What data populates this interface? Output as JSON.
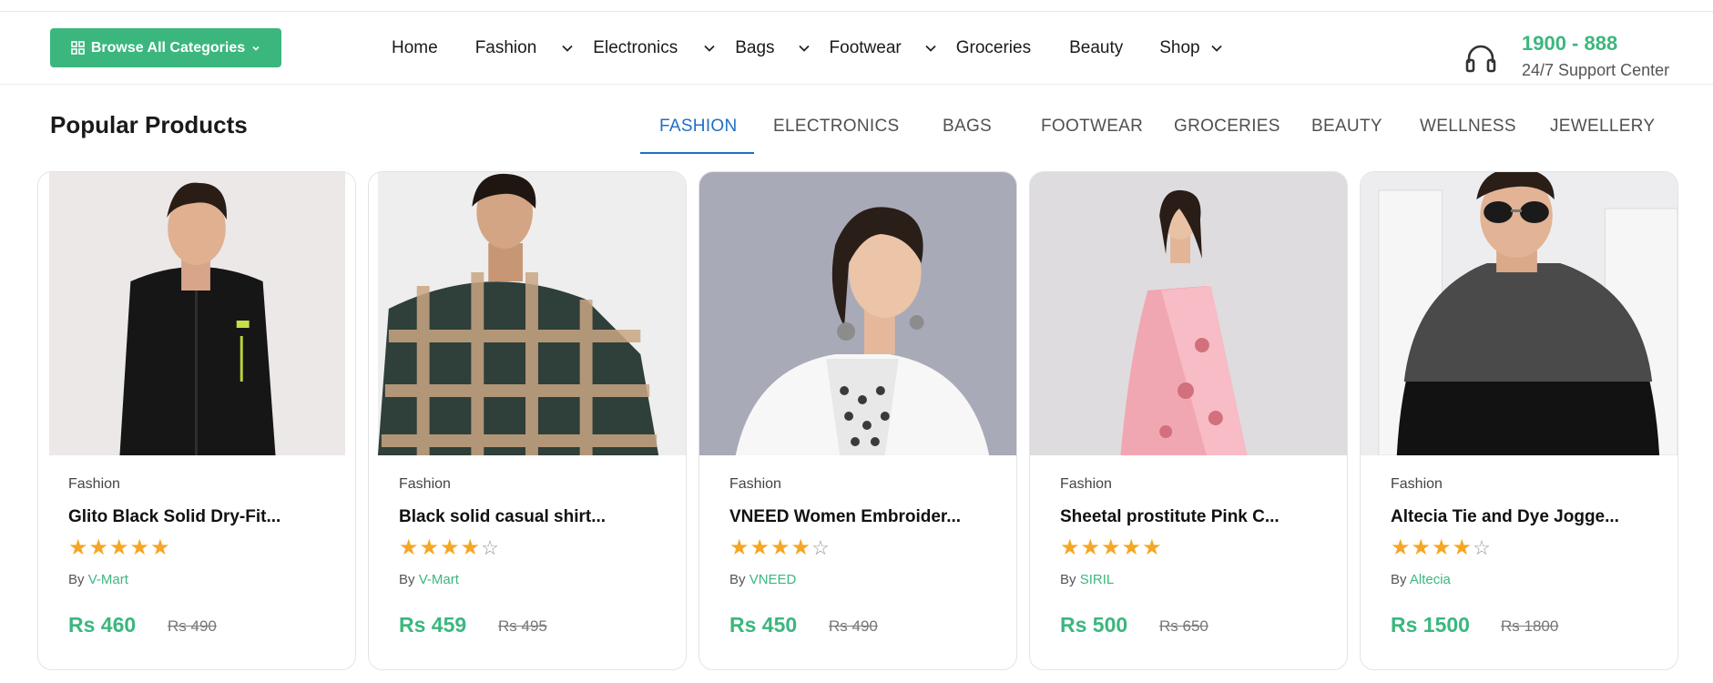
{
  "header": {
    "browse_label": "Browse All Categories",
    "nav": [
      {
        "label": "Home",
        "dropdown": false
      },
      {
        "label": "Fashion",
        "dropdown": true
      },
      {
        "label": "Electronics",
        "dropdown": true
      },
      {
        "label": "Bags",
        "dropdown": true
      },
      {
        "label": "Footwear",
        "dropdown": true
      },
      {
        "label": "Groceries",
        "dropdown": false
      },
      {
        "label": "Beauty",
        "dropdown": false
      },
      {
        "label": "Shop",
        "dropdown": true
      }
    ],
    "support_phone": "1900 - 888",
    "support_label": "24/7 Support Center"
  },
  "section": {
    "title": "Popular Products",
    "tabs": [
      "Fashion",
      "Electronics",
      "Bags",
      "Footwear",
      "Groceries",
      "Beauty",
      "Wellness",
      "Jewellery"
    ],
    "active_tab": "Fashion"
  },
  "products": [
    {
      "category": "Fashion",
      "name": "Glito Black Solid Dry-Fit...",
      "rating": 5,
      "by_prefix": "By",
      "brand": "V-Mart",
      "price": "Rs 460",
      "old_price": "Rs 490"
    },
    {
      "category": "Fashion",
      "name": "Black solid casual shirt...",
      "rating": 4,
      "by_prefix": "By",
      "brand": "V-Mart",
      "price": "Rs 459",
      "old_price": "Rs 495"
    },
    {
      "category": "Fashion",
      "name": "VNEED Women Embroider...",
      "rating": 4,
      "by_prefix": "By",
      "brand": "VNEED",
      "price": "Rs 450",
      "old_price": "Rs 490"
    },
    {
      "category": "Fashion",
      "name": "Sheetal prostitute Pink C...",
      "rating": 5,
      "by_prefix": "By",
      "brand": "SIRIL",
      "price": "Rs 500",
      "old_price": "Rs 650"
    },
    {
      "category": "Fashion",
      "name": "Altecia Tie and Dye Jogge...",
      "rating": 4,
      "by_prefix": "By",
      "brand": "Altecia",
      "price": "Rs 1500",
      "old_price": "Rs 1800"
    }
  ],
  "colors": {
    "accent": "#3bb77e",
    "tab_active": "#1f6fc5",
    "star": "#f5a623"
  }
}
